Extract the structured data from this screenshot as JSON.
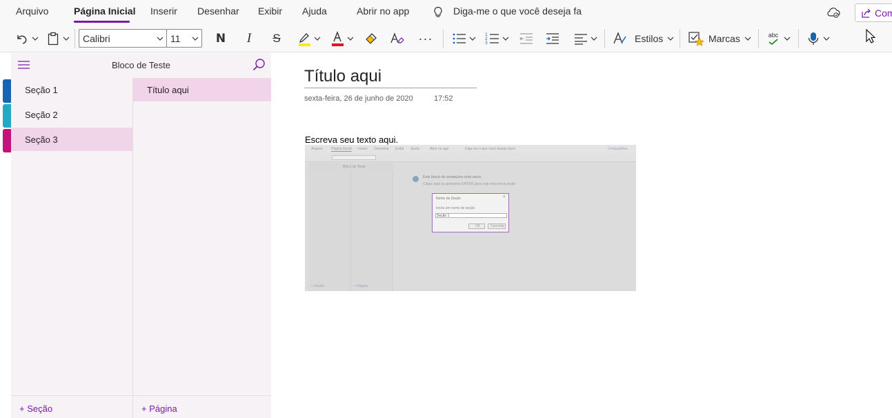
{
  "menu": {
    "tabs": [
      {
        "label": "Arquivo"
      },
      {
        "label": "Página Inicial"
      },
      {
        "label": "Inserir"
      },
      {
        "label": "Desenhar"
      },
      {
        "label": "Exibir"
      },
      {
        "label": "Ajuda"
      },
      {
        "label": "Abrir no app"
      }
    ],
    "tell_me": "Diga-me o que você deseja fa",
    "share_label": "Com",
    "active_tab": "Página Inicial"
  },
  "ribbon": {
    "font_name": "Calibri",
    "font_size": "11",
    "bold": "N",
    "italic": "I",
    "strike": "S",
    "more": "···",
    "styles_label": "Estilos",
    "tags_label": "Marcas",
    "spell_abc": "abc",
    "icons": [
      "undo-icon",
      "clipboard-icon",
      "highlight-icon",
      "font-color-icon",
      "format-painter-icon",
      "clear-format-icon",
      "bullets-icon",
      "numbering-icon",
      "outdent-icon",
      "indent-icon",
      "align-icon",
      "styles-icon",
      "tags-icon",
      "spelling-icon",
      "dictate-icon"
    ],
    "colors": {
      "highlight": "#ffeb00",
      "font_color": "#e81123"
    }
  },
  "notebook": {
    "title": "Bloco de Teste",
    "sections": [
      {
        "label": "Seção 1",
        "color": "#1664b4"
      },
      {
        "label": "Seção 2",
        "color": "#24a8c4"
      },
      {
        "label": "Seção 3",
        "color": "#c4117b"
      }
    ],
    "selected_section": "Seção 3",
    "pages": [
      {
        "label": "Título aqui"
      }
    ],
    "add_section": "+ Seção",
    "add_page": "+ Página"
  },
  "page": {
    "title": "Título aqui",
    "date": "sexta-feira, 26 de junho de 2020",
    "time": "17:52",
    "body": "Escreva seu texto aqui."
  },
  "embedded_screenshot": {
    "tabs": [
      "Arquivo",
      "Página Inicial",
      "Inserir",
      "Desenhar",
      "Exibir",
      "Ajuda",
      "Abrir no app"
    ],
    "tell_me": "Diga-me o que você deseja fazer",
    "share": "Compartilhar",
    "notebook_title": "Bloco de Teste",
    "empty_notice": "Este bloco de anotações está vazio.",
    "empty_hint": "Clique aqui ou pressione ENTER para criar uma nova seção.",
    "dialog_title": "Nome da Seção",
    "dialog_prompt": "Insira um nome de seção",
    "dialog_value": "Seção 1",
    "ok": "OK",
    "cancel": "Cancelar",
    "add_section": "+ Seção",
    "add_page": "+ Página"
  },
  "theme": {
    "accent": "#7719aa",
    "nav_bg": "#f7f2f6",
    "selected_bg": "#f2d4e9"
  }
}
